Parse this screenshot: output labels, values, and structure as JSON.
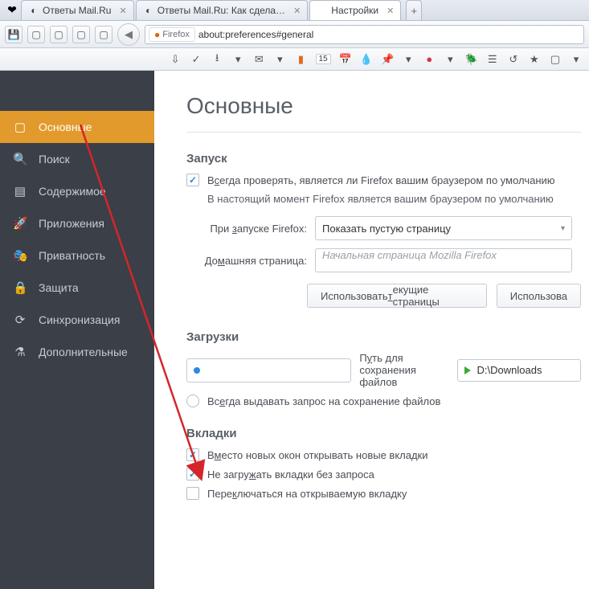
{
  "tabs": {
    "t0_label": "Ответы Mail.Ru",
    "t1_label": "Ответы Mail.Ru: Как сдела…",
    "t2_label": "Настройки"
  },
  "url": "about:preferences#general",
  "urlchip": "Firefox",
  "iconbar": {
    "count": "15"
  },
  "sidebar": {
    "items": [
      {
        "label": "Основные"
      },
      {
        "label": "Поиск"
      },
      {
        "label": "Содержимое"
      },
      {
        "label": "Приложения"
      },
      {
        "label": "Приватность"
      },
      {
        "label": "Защита"
      },
      {
        "label": "Синхронизация"
      },
      {
        "label": "Дополнительные"
      }
    ]
  },
  "page": {
    "title": "Основные",
    "startup": {
      "heading": "Запуск",
      "check_default_pre": "В",
      "check_default_u": "с",
      "check_default_post": "егда проверять, является ли Firefox вашим браузером по умолчанию",
      "status": "В настоящий момент Firefox является вашим браузером по умолчанию",
      "onstart_label_pre": "При ",
      "onstart_label_u": "з",
      "onstart_label_post": "апуске Firefox:",
      "onstart_value": "Показать пустую страницу",
      "home_label_pre": "До",
      "home_label_u": "м",
      "home_label_post": "ашняя страница:",
      "home_placeholder": "Начальная страница Mozilla Firefox",
      "btn_current_pre": "Использовать ",
      "btn_current_u": "т",
      "btn_current_post": "екущие страницы",
      "btn_bookmark": "Использова"
    },
    "downloads": {
      "heading": "Загрузки",
      "saveto_pre": "П",
      "saveto_u": "у",
      "saveto_post": "ть для сохранения файлов",
      "path": "D:\\Downloads",
      "ask_pre": "Вс",
      "ask_u": "е",
      "ask_post": "гда выдавать запрос на сохранение файлов"
    },
    "tabs": {
      "heading": "Вкладки",
      "new_pre": "В",
      "new_u": "м",
      "new_post": "есто новых окон открывать новые вкладки",
      "noload_pre": "Не загру",
      "noload_u": "ж",
      "noload_post": "ать вкладки без запроса",
      "switch_pre": "Пере",
      "switch_u": "к",
      "switch_post": "лючаться на открываемую вкладку"
    }
  }
}
